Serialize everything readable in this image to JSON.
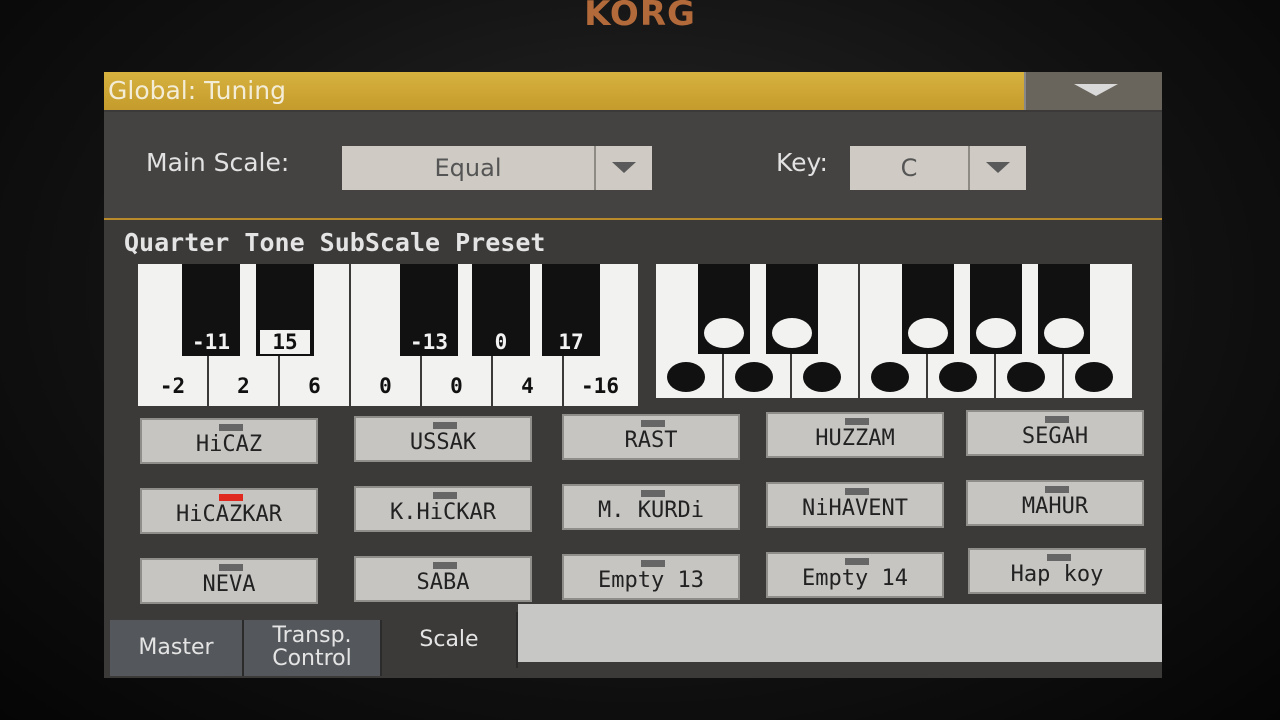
{
  "device_logo": "KORG",
  "header": {
    "title": "Global: Tuning"
  },
  "main_scale": {
    "label": "Main Scale:",
    "value": "Equal"
  },
  "key": {
    "label": "Key:",
    "value": "C"
  },
  "section_title": "Quarter Tone SubScale Preset",
  "keyboard": {
    "white_values": [
      "-2",
      "2",
      "6",
      "0",
      "0",
      "4",
      "-16"
    ],
    "black_values": [
      "-11",
      "15",
      "-13",
      "0",
      "17"
    ]
  },
  "presets": [
    {
      "label": "HiCAZ",
      "active": false
    },
    {
      "label": "USSAK",
      "active": false
    },
    {
      "label": "RAST",
      "active": false
    },
    {
      "label": "HUZZAM",
      "active": false
    },
    {
      "label": "SEGAH",
      "active": false
    },
    {
      "label": "HiCAZKAR",
      "active": true
    },
    {
      "label": "K.HiCKAR",
      "active": false
    },
    {
      "label": "M. KURDi",
      "active": false
    },
    {
      "label": "NiHAVENT",
      "active": false
    },
    {
      "label": "MAHUR",
      "active": false
    },
    {
      "label": "NEVA",
      "active": false
    },
    {
      "label": "SABA",
      "active": false
    },
    {
      "label": "Empty 13",
      "active": false
    },
    {
      "label": "Empty 14",
      "active": false
    },
    {
      "label": "Hap koy",
      "active": false
    }
  ],
  "tabs": {
    "master": "Master",
    "transp_line1": "Transp.",
    "transp_line2": "Control",
    "scale": "Scale"
  },
  "colors": {
    "title_bar": "#c9a233",
    "active_led": "#e0291f"
  }
}
